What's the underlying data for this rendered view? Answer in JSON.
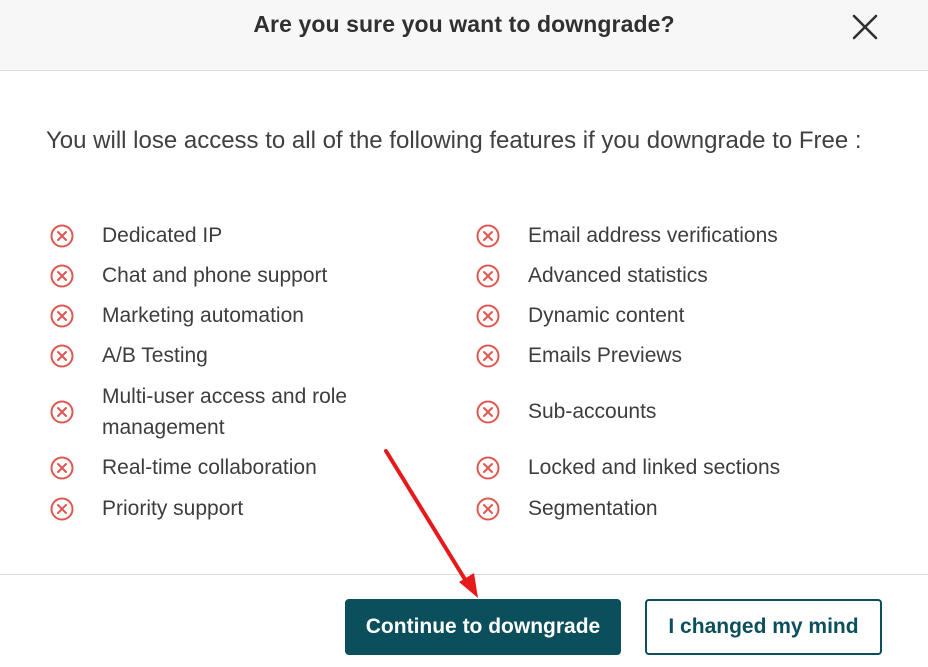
{
  "dialog": {
    "title": "Are you sure you want to downgrade?",
    "close_icon": "close-icon",
    "intro_text": "You will lose access to all of the following features if you downgrade to Free :"
  },
  "features": {
    "left": [
      "Dedicated IP",
      "Chat and phone support",
      "Marketing automation",
      "A/B Testing",
      "Multi-user access and role management",
      "Real-time collaboration",
      "Priority support"
    ],
    "right": [
      "Email address verifications",
      "Advanced statistics",
      "Dynamic content",
      "Emails Previews",
      "Sub-accounts",
      "Locked and linked sections",
      "Segmentation"
    ],
    "icon": "circle-x-icon"
  },
  "buttons": {
    "continue_label": "Continue to downgrade",
    "cancel_label": "I changed my mind"
  },
  "colors": {
    "accent": "#0b4f5c",
    "x_icon": "#e0574f",
    "annotation_arrow": "#e8191b"
  }
}
